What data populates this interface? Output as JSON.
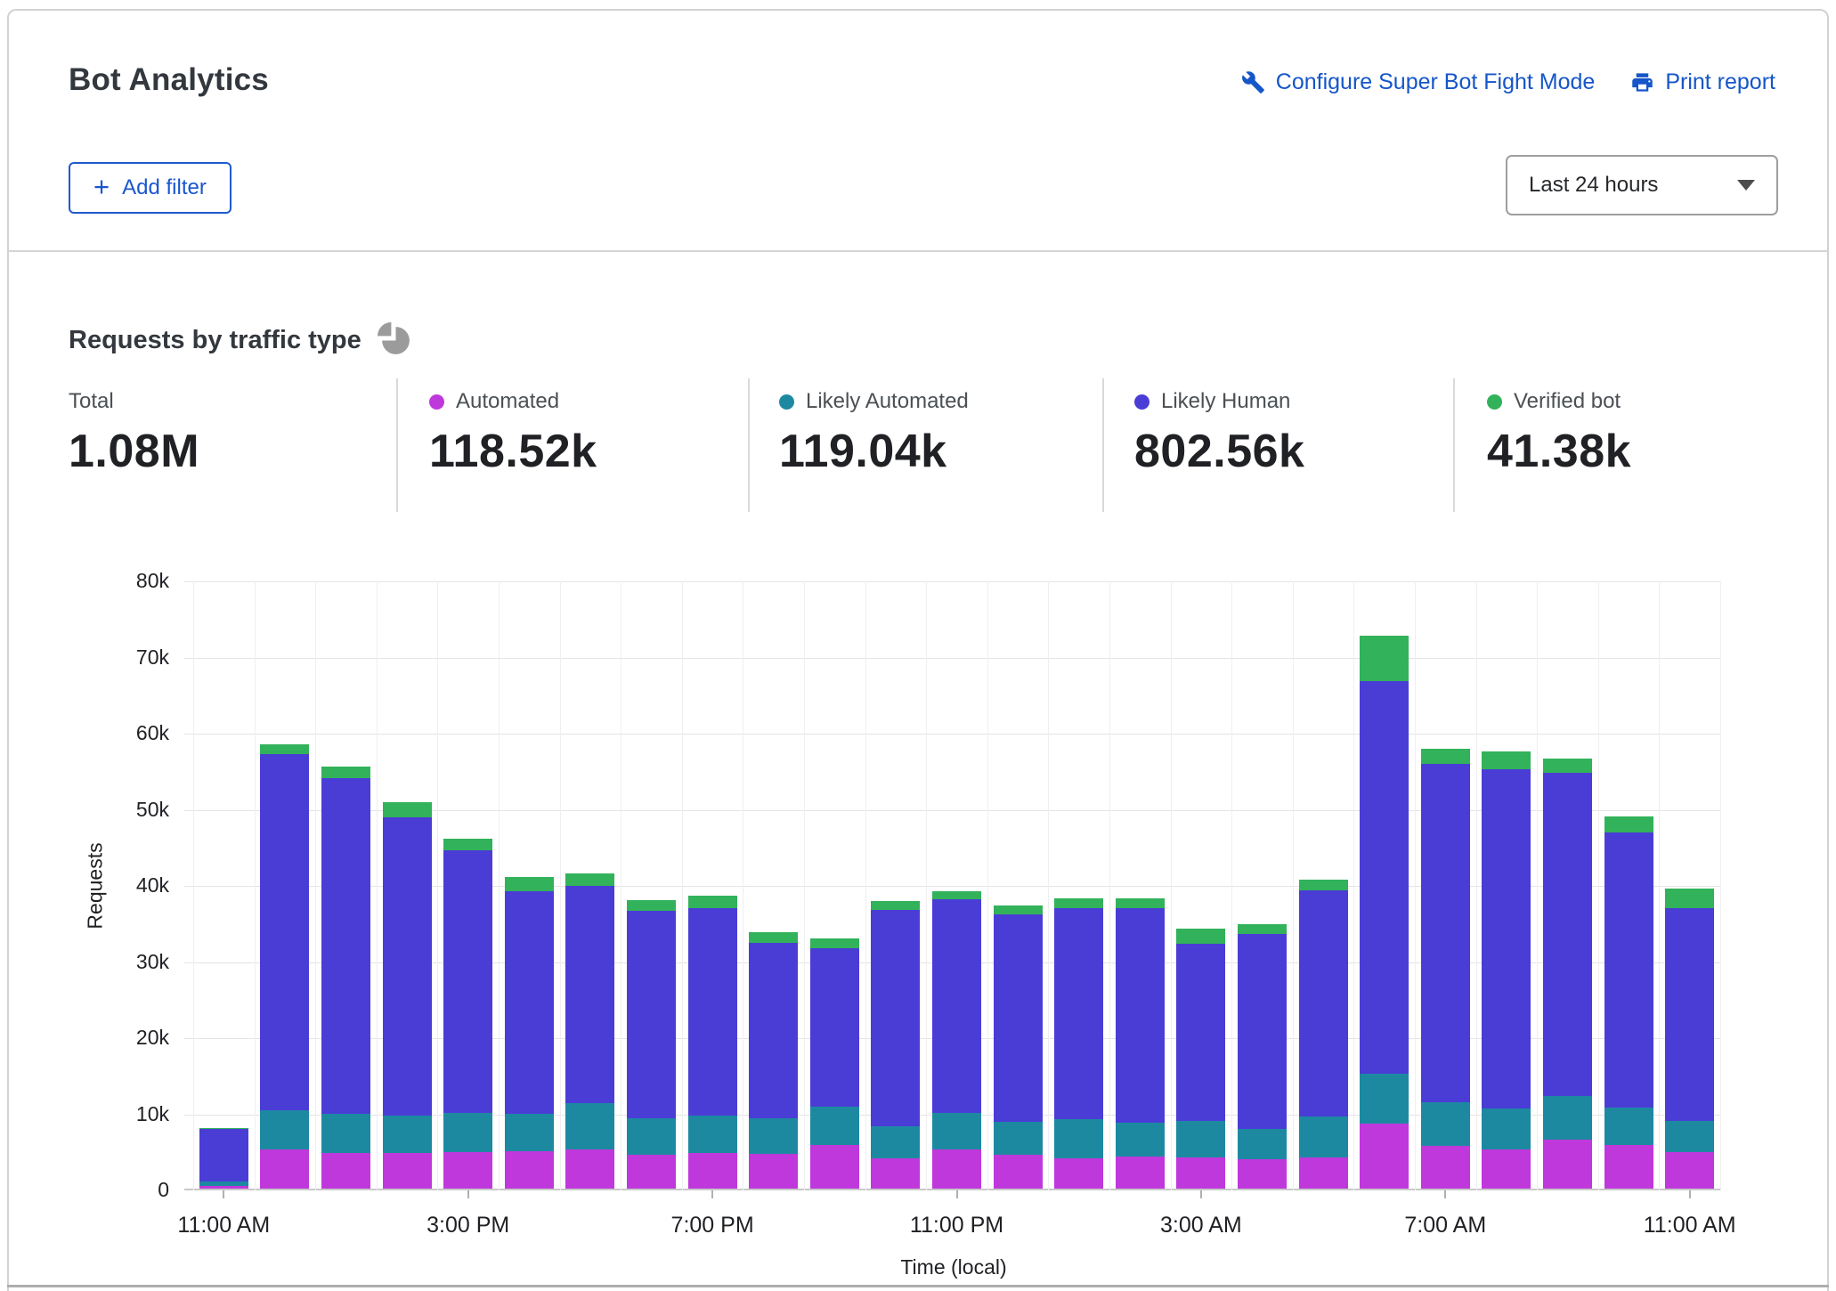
{
  "header": {
    "title": "Bot Analytics",
    "configure_link": "Configure Super Bot Fight Mode",
    "print_link": "Print report",
    "add_filter_plus": "+",
    "add_filter_label": "Add filter",
    "time_range": "Last 24 hours"
  },
  "section": {
    "heading": "Requests by traffic type"
  },
  "icons": {
    "wrench": "wrench-icon",
    "printer": "printer-icon",
    "plus": "plus-icon",
    "caret": "caret-down-icon",
    "pie": "pie-chart-icon"
  },
  "colors": {
    "link_blue": "#1556c8",
    "button_blue": "#1f5acd",
    "automated": "#bf38dc",
    "likely_automated": "#1d89a1",
    "likely_human": "#4a3dd6",
    "verified_bot": "#32b25a",
    "pie_icon_gray": "#9b9b9b"
  },
  "stats": [
    {
      "label": "Total",
      "value": "1.08M",
      "color": null
    },
    {
      "label": "Automated",
      "value": "118.52k",
      "color": "#bf38dc"
    },
    {
      "label": "Likely Automated",
      "value": "119.04k",
      "color": "#1d89a1"
    },
    {
      "label": "Likely Human",
      "value": "802.56k",
      "color": "#4a3dd6"
    },
    {
      "label": "Verified bot",
      "value": "41.38k",
      "color": "#32b25a"
    }
  ],
  "chart_data": {
    "type": "bar",
    "stacked": true,
    "title": "Requests by traffic type",
    "xlabel": "Time (local)",
    "ylabel": "Requests",
    "ylim": [
      0,
      80000
    ],
    "grid": true,
    "num_bars": 25,
    "y_ticks": [
      "0",
      "10k",
      "20k",
      "30k",
      "40k",
      "50k",
      "60k",
      "70k",
      "80k"
    ],
    "x_tick_labels": [
      "11:00 AM",
      "3:00 PM",
      "7:00 PM",
      "11:00 PM",
      "3:00 AM",
      "7:00 AM",
      "11:00 AM"
    ],
    "x_tick_positions": [
      0,
      4,
      8,
      12,
      16,
      20,
      24
    ],
    "series": [
      {
        "name": "Automated",
        "color": "#bf38dc",
        "values": [
          400,
          5200,
          4700,
          4700,
          4800,
          4900,
          5200,
          4500,
          4700,
          4600,
          5700,
          4000,
          5100,
          4500,
          4000,
          4200,
          4100,
          3900,
          4100,
          8500,
          5600,
          5200,
          6400,
          5700,
          4800
        ]
      },
      {
        "name": "Likely Automated",
        "color": "#1d89a1",
        "values": [
          600,
          5100,
          5100,
          4900,
          5200,
          4900,
          6000,
          4700,
          4900,
          4600,
          5100,
          4200,
          4800,
          4300,
          5100,
          4500,
          4800,
          3900,
          5400,
          6600,
          5800,
          5300,
          5800,
          5000,
          4100
        ]
      },
      {
        "name": "Likely Human",
        "color": "#4a3dd6",
        "values": [
          6800,
          46800,
          44100,
          39200,
          34500,
          29300,
          28600,
          27300,
          27200,
          23100,
          20800,
          28400,
          28100,
          27200,
          27700,
          28100,
          23300,
          25700,
          29700,
          51600,
          44400,
          44600,
          42400,
          36100,
          27900
        ]
      },
      {
        "name": "Verified bot",
        "color": "#32b25a",
        "values": [
          200,
          1300,
          1500,
          2000,
          1500,
          1800,
          1600,
          1400,
          1700,
          1400,
          1300,
          1200,
          1100,
          1200,
          1300,
          1300,
          2000,
          1300,
          1400,
          5900,
          2000,
          2300,
          1900,
          2100,
          2600
        ]
      }
    ]
  }
}
